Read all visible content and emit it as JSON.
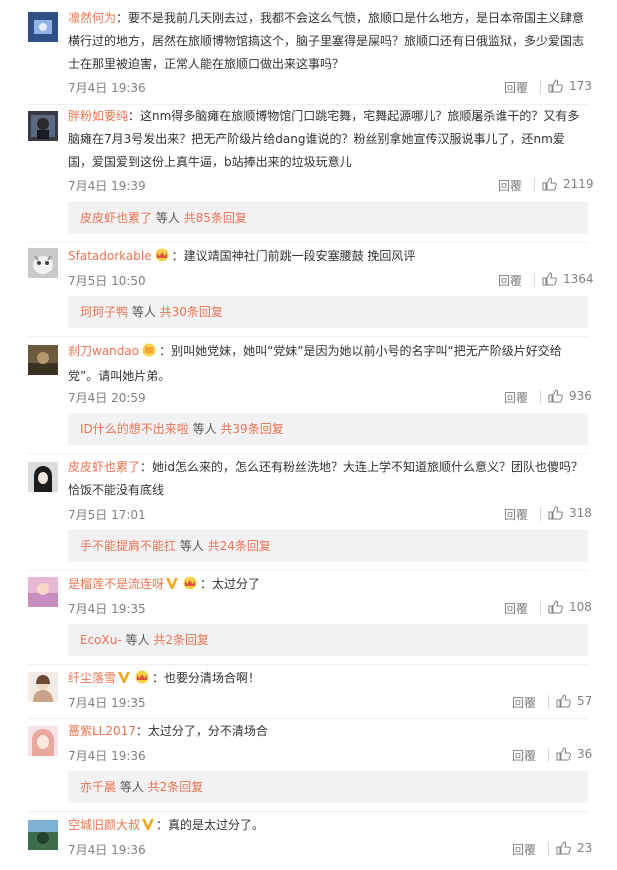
{
  "comments": [
    {
      "user": "凛然何为",
      "text": "：要不是我前几天刚去过，我都不会这么气愤，旅顺口是什么地方，是日本帝国主义肆意横行过的地方，居然在旅顺博物馆搞这个，脑子里塞得是屎吗？旅顺口还有日俄监狱，多少爱国志士在那里被迫害，正常人能在旅顺口做出来这事吗？",
      "time": "7月4日 19:36",
      "reply": "回覆",
      "likes": "173"
    },
    {
      "user": "胖粉如要纯",
      "text": "：这nm得多脑瘫在旅顺博物馆门口跳宅舞，宅舞起源哪儿？旅顺屠杀谁干的？又有多脑瘫在7月3号发出来？把无产阶级片给dang谁说的？粉丝别拿她宣传汉服说事儿了，还nm爱国，爱国爱到这份上真牛逼，b站捧出来的垃圾玩意儿",
      "time": "7月4日 19:39",
      "reply": "回覆",
      "likes": "2119",
      "thread": {
        "name": "皮皮虾也累了",
        "mid": " 等人 ",
        "count": "共85条回复"
      }
    },
    {
      "user": "Sfatadorkable",
      "text": "：建议靖国神社门前跳一段安塞腰鼓 挽回风评",
      "time": "7月5日 10:50",
      "reply": "回覆",
      "likes": "1364",
      "thread": {
        "name": "珂珂子鸭",
        "mid": " 等人 ",
        "count": "共30条回复"
      }
    },
    {
      "user": "刹刀wandao",
      "text": "：别叫她党妹，她叫“党妹”是因为她以前小号的名字叫“把无产阶级片好交给党”。请叫她片弟。",
      "time": "7月4日 20:59",
      "reply": "回覆",
      "likes": "936",
      "thread": {
        "name": "ID什么的想不出来啦",
        "mid": " 等人 ",
        "count": "共39条回复"
      }
    },
    {
      "user": "皮皮虾也累了",
      "text": "：她id怎么来的，怎么还有粉丝洗地？大连上学不知道旅顺什么意义？团队也傻吗？恰饭不能没有底线",
      "time": "7月5日 17:01",
      "reply": "回覆",
      "likes": "318",
      "thread": {
        "name": "手不能提肩不能扛",
        "mid": " 等人 ",
        "count": "共24条回复"
      }
    },
    {
      "user": "是榴莲不是流连呀",
      "text": "：太过分了",
      "time": "7月4日 19:35",
      "reply": "回覆",
      "likes": "108",
      "thread": {
        "name": "EcoXu-",
        "mid": " 等人 ",
        "count": "共2条回复"
      }
    },
    {
      "user": "纤尘落雪",
      "text": "：也要分清场合啊！",
      "time": "7月4日 19:35",
      "reply": "回覆",
      "likes": "57"
    },
    {
      "user": "蔷紫LL2017",
      "text": "：太过分了，分不清场合",
      "time": "7月4日 19:36",
      "reply": "回覆",
      "likes": "36",
      "thread": {
        "name": "亦千晨",
        "mid": " 等人 ",
        "count": "共2条回复"
      }
    },
    {
      "user": "空城旧颜大叔",
      "text": "：真的是太过分了。",
      "time": "7月4日 19:36",
      "reply": "回覆",
      "likes": "23"
    }
  ]
}
